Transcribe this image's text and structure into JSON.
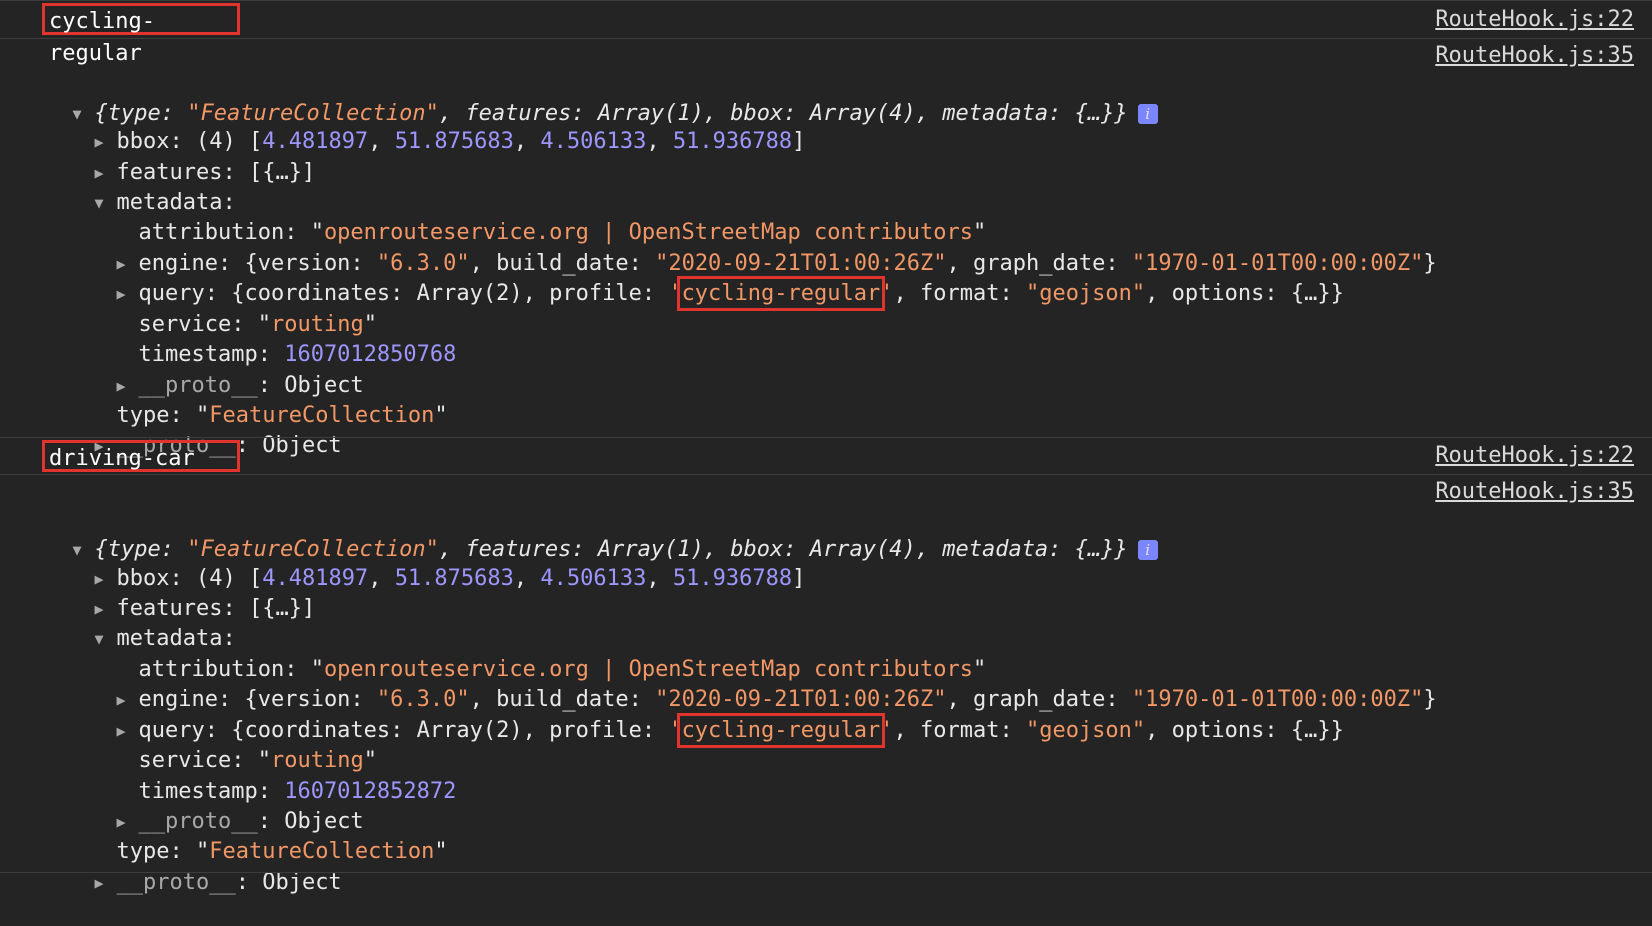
{
  "messages": [
    {
      "log_text": "cycling-regular",
      "source1": "RouteHook.js:22",
      "source2": "RouteHook.js:35",
      "summary": {
        "open": "{",
        "type_key": "type: ",
        "type_val": "\"FeatureCollection\"",
        "rest": ", features: Array(1), bbox: Array(4), metadata: {…}}",
        "info_icon": "i"
      },
      "bbox": {
        "key": "bbox: ",
        "count": "(4) [",
        "v1": "4.481897",
        "v2": "51.875683",
        "v3": "4.506133",
        "v4": "51.936788",
        "close": "]"
      },
      "features": {
        "key": "features: ",
        "val": "[{…}]"
      },
      "metadata": {
        "key": "metadata:"
      },
      "attribution": {
        "key": "attribution: ",
        "val": "openrouteservice.org | OpenStreetMap contributors"
      },
      "engine": {
        "key": "engine: ",
        "p1": "{version: ",
        "version": "\"6.3.0\"",
        "p2": ", build_date: ",
        "build_date": "\"2020-09-21T01:00:26Z\"",
        "p3": ", graph_date: ",
        "graph_date": "\"1970-01-01T00:00:00Z\"",
        "p4": "}"
      },
      "query": {
        "key": "query: ",
        "p1": "{coordinates: Array(2), profile: ",
        "profile_q1": "'",
        "profile": "cycling-regular",
        "profile_q2": "'",
        "p2": ", format: ",
        "format": "\"geojson\"",
        "p3": ", options: {…}}"
      },
      "service": {
        "key": "service: ",
        "val": "routing"
      },
      "timestamp": {
        "key": "timestamp: ",
        "val": "1607012850768"
      },
      "proto_inner": {
        "key": "__proto__",
        "val": ": Object"
      },
      "type": {
        "key": "type: ",
        "val": "FeatureCollection"
      },
      "proto_outer": {
        "key": "__proto__",
        "val": ": Object"
      }
    },
    {
      "log_text": "driving-car",
      "source1": "RouteHook.js:22",
      "source2": "RouteHook.js:35",
      "summary": {
        "open": "{",
        "type_key": "type: ",
        "type_val": "\"FeatureCollection\"",
        "rest": ", features: Array(1), bbox: Array(4), metadata: {…}}",
        "info_icon": "i"
      },
      "bbox": {
        "key": "bbox: ",
        "count": "(4) [",
        "v1": "4.481897",
        "v2": "51.875683",
        "v3": "4.506133",
        "v4": "51.936788",
        "close": "]"
      },
      "features": {
        "key": "features: ",
        "val": "[{…}]"
      },
      "metadata": {
        "key": "metadata:"
      },
      "attribution": {
        "key": "attribution: ",
        "val": "openrouteservice.org | OpenStreetMap contributors"
      },
      "engine": {
        "key": "engine: ",
        "p1": "{version: ",
        "version": "\"6.3.0\"",
        "p2": ", build_date: ",
        "build_date": "\"2020-09-21T01:00:26Z\"",
        "p3": ", graph_date: ",
        "graph_date": "\"1970-01-01T00:00:00Z\"",
        "p4": "}"
      },
      "query": {
        "key": "query: ",
        "p1": "{coordinates: Array(2), profile: ",
        "profile_q1": "'",
        "profile": "cycling-regular",
        "profile_q2": "'",
        "p2": ", format: ",
        "format": "\"geojson\"",
        "p3": ", options: {…}}"
      },
      "service": {
        "key": "service: ",
        "val": "routing"
      },
      "timestamp": {
        "key": "timestamp: ",
        "val": "1607012852872"
      },
      "proto_inner": {
        "key": "__proto__",
        "val": ": Object"
      },
      "type": {
        "key": "type: ",
        "val": "FeatureCollection"
      },
      "proto_outer": {
        "key": "__proto__",
        "val": ": Object"
      }
    }
  ],
  "icons": {
    "expanded": "▼",
    "collapsed": "▶"
  }
}
